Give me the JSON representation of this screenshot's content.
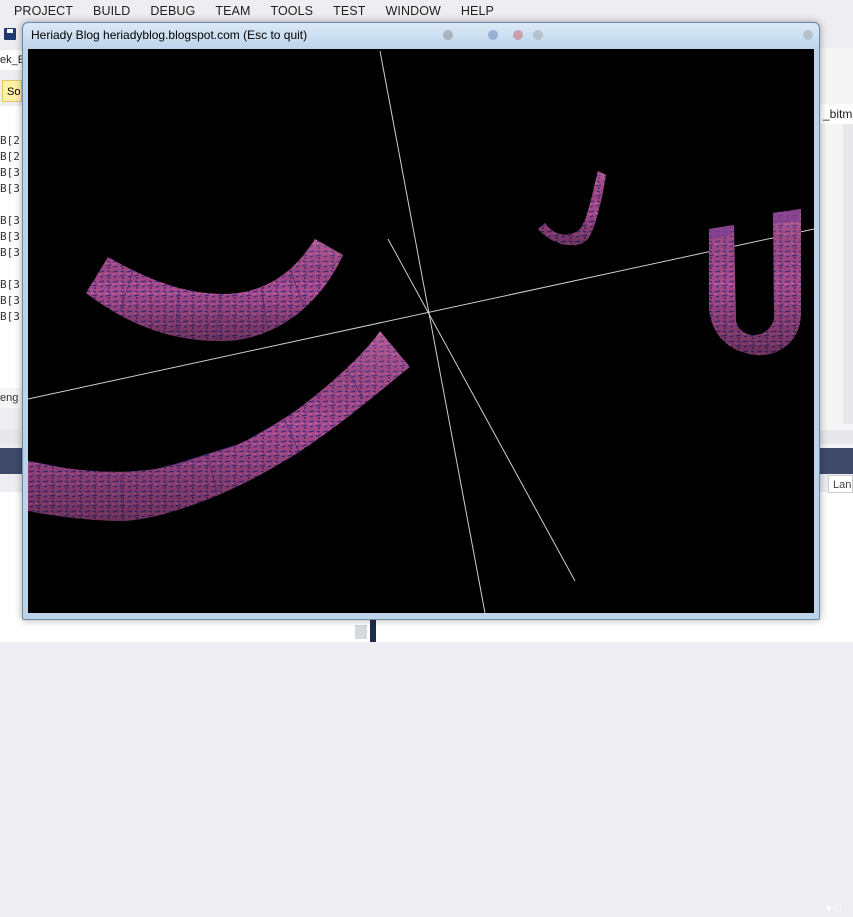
{
  "menu": {
    "items": [
      "PROJECT",
      "BUILD",
      "DEBUG",
      "TEAM",
      "TOOLS",
      "TEST",
      "WINDOW",
      "HELP"
    ]
  },
  "background": {
    "doc_tab": "ek_E",
    "solution_tab": "So",
    "bitmap_tab": "_bitma",
    "output_label": "eng",
    "lang_label": "Lan",
    "panel_pin": "▾ □",
    "code_lines": [
      "B[2",
      "B[2",
      "B[3",
      "B[3",
      "B[3",
      "B[3",
      "B[3",
      "B[3",
      "B[3",
      "B[3"
    ]
  },
  "gl_window": {
    "title": "Heriady Blog heriadyblog.blogspot.com (Esc to quit)"
  },
  "scene": {
    "background": "#000000",
    "axis_color": "#d0d0d0",
    "tube_color": "#b0508f",
    "tube_dark": "#3f3a8c",
    "objects": [
      "tube-small-j",
      "tube-u",
      "tube-arc-upper-left",
      "tube-arc-lower-left"
    ]
  }
}
